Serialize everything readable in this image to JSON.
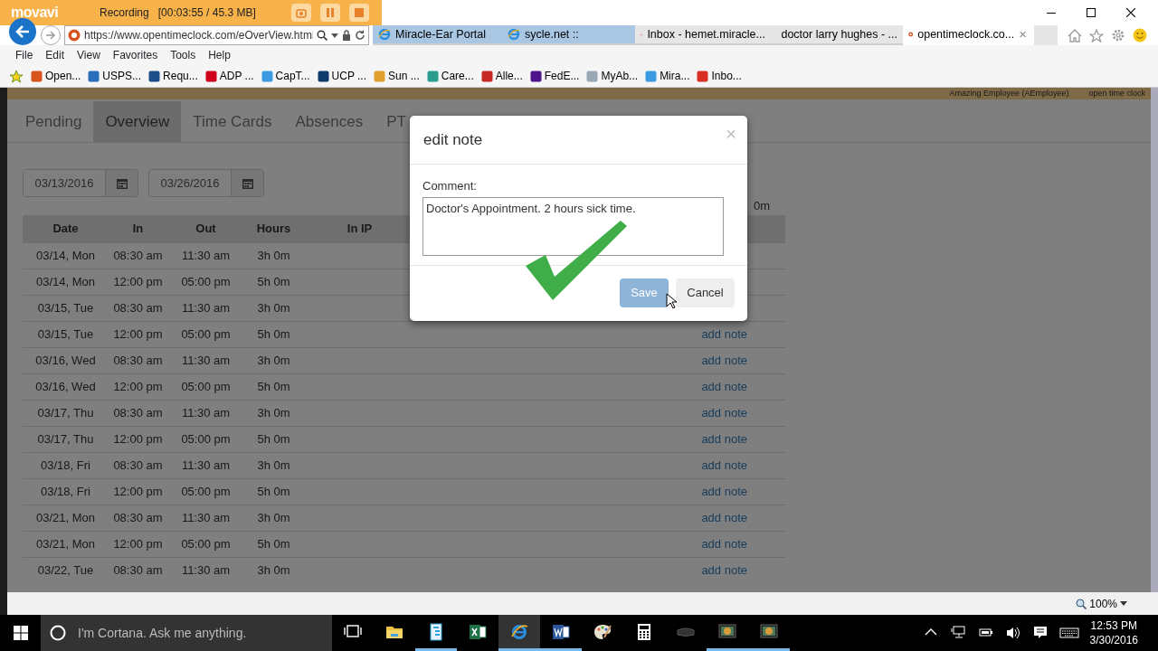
{
  "recorder": {
    "brand": "movavi",
    "status": "Recording",
    "timer": "[00:03:55 / 45.3 MB]"
  },
  "browser": {
    "address": "https://www.opentimeclock.com/eOverView.html",
    "tabs": [
      {
        "label": "Miracle-Ear Portal",
        "kind": "ie",
        "color": "#a9c6e3",
        "selected": false
      },
      {
        "label": "sycle.net ::",
        "kind": "ie",
        "color": "#a9c6e3",
        "selected": false
      },
      {
        "label": "Inbox - hemet.miracle...",
        "kind": "gmail",
        "selected": false
      },
      {
        "label": "doctor larry hughes - ...",
        "kind": "google",
        "selected": false
      },
      {
        "label": "opentimeclock.co...",
        "kind": "clock",
        "selected": true,
        "close": "×"
      }
    ],
    "menu": [
      "File",
      "Edit",
      "View",
      "Favorites",
      "Tools",
      "Help"
    ],
    "favorites": [
      {
        "label": "Open...",
        "color": "#d9531e"
      },
      {
        "label": "USPS...",
        "color": "#2a6db8"
      },
      {
        "label": "Requ...",
        "color": "#1d4e89"
      },
      {
        "label": "ADP ...",
        "color": "#d0021b"
      },
      {
        "label": "CapT...",
        "color": "#3c9be0"
      },
      {
        "label": "UCP ...",
        "color": "#123b6d"
      },
      {
        "label": "Sun ...",
        "color": "#e0a030"
      },
      {
        "label": "Care...",
        "color": "#2a9d8f"
      },
      {
        "label": "Alle...",
        "color": "#c62828"
      },
      {
        "label": "FedE...",
        "color": "#4d148c"
      },
      {
        "label": "MyAb...",
        "color": "#9aa7b5"
      },
      {
        "label": "Mira...",
        "color": "#3c9be0"
      },
      {
        "label": "Inbo...",
        "color": "#d93025"
      }
    ],
    "zoom": "100%"
  },
  "page": {
    "user": "Amazing Employee (AEmployee)",
    "brand": "open time clock",
    "nav": [
      {
        "label": "Pending",
        "selected": false
      },
      {
        "label": "Overview",
        "selected": true
      },
      {
        "label": "Time Cards",
        "selected": false
      },
      {
        "label": "Absences",
        "selected": false
      },
      {
        "label": "PT",
        "selected": false
      }
    ],
    "date_from": "03/13/2016",
    "date_to": "03/26/2016",
    "total": "0m",
    "columns": [
      "Date",
      "In",
      "Out",
      "Hours",
      "In IP"
    ],
    "rows": [
      {
        "cells": [
          "03/14, Mon",
          "08:30 am",
          "11:30 am",
          "3h 0m"
        ]
      },
      {
        "cells": [
          "03/14, Mon",
          "12:00 pm",
          "05:00 pm",
          "5h 0m"
        ]
      },
      {
        "cells": [
          "03/15, Tue",
          "08:30 am",
          "11:30 am",
          "3h 0m"
        ]
      },
      {
        "cells": [
          "03/15, Tue",
          "12:00 pm",
          "05:00 pm",
          "5h 0m"
        ],
        "note": "add note"
      },
      {
        "cells": [
          "03/16, Wed",
          "08:30 am",
          "11:30 am",
          "3h 0m"
        ],
        "note": "add note"
      },
      {
        "cells": [
          "03/16, Wed",
          "12:00 pm",
          "05:00 pm",
          "5h 0m"
        ],
        "note": "add note"
      },
      {
        "cells": [
          "03/17, Thu",
          "08:30 am",
          "11:30 am",
          "3h 0m"
        ],
        "note": "add note"
      },
      {
        "cells": [
          "03/17, Thu",
          "12:00 pm",
          "05:00 pm",
          "5h 0m"
        ],
        "note": "add note"
      },
      {
        "cells": [
          "03/18, Fri",
          "08:30 am",
          "11:30 am",
          "3h 0m"
        ],
        "note": "add note"
      },
      {
        "cells": [
          "03/18, Fri",
          "12:00 pm",
          "05:00 pm",
          "5h 0m"
        ],
        "note": "add note"
      },
      {
        "cells": [
          "03/21, Mon",
          "08:30 am",
          "11:30 am",
          "3h 0m"
        ],
        "note": "add note"
      },
      {
        "cells": [
          "03/21, Mon",
          "12:00 pm",
          "05:00 pm",
          "5h 0m"
        ],
        "note": "add note"
      },
      {
        "cells": [
          "03/22, Tue",
          "08:30 am",
          "11:30 am",
          "3h 0m"
        ],
        "note": "add note"
      }
    ]
  },
  "dialog": {
    "title": "edit note",
    "close": "×",
    "label": "Comment:",
    "comment": "Doctor's Appointment. 2 hours sick time.",
    "buttons": [
      {
        "label": "Save",
        "kind": "primary",
        "disabled": true
      },
      {
        "label": "Cancel",
        "kind": "default",
        "disabled": false
      }
    ]
  },
  "taskbar": {
    "search_placeholder": "I'm Cortana. Ask me anything.",
    "apps": [
      {
        "kind": "taskview",
        "running": false,
        "selected": false
      },
      {
        "kind": "folder",
        "running": false,
        "selected": false
      },
      {
        "kind": "notes",
        "running": true,
        "selected": false
      },
      {
        "kind": "excel",
        "running": false,
        "selected": false
      },
      {
        "kind": "ie",
        "running": true,
        "selected": true
      },
      {
        "kind": "word",
        "running": true,
        "selected": false
      },
      {
        "kind": "paint",
        "running": false,
        "selected": false
      },
      {
        "kind": "calculator",
        "running": false,
        "selected": false
      },
      {
        "kind": "device",
        "running": false,
        "selected": false
      },
      {
        "kind": "screen",
        "running": true,
        "selected": false
      },
      {
        "kind": "screen",
        "running": true,
        "selected": false
      }
    ],
    "time": "12:53 PM",
    "date": "3/30/2016"
  }
}
